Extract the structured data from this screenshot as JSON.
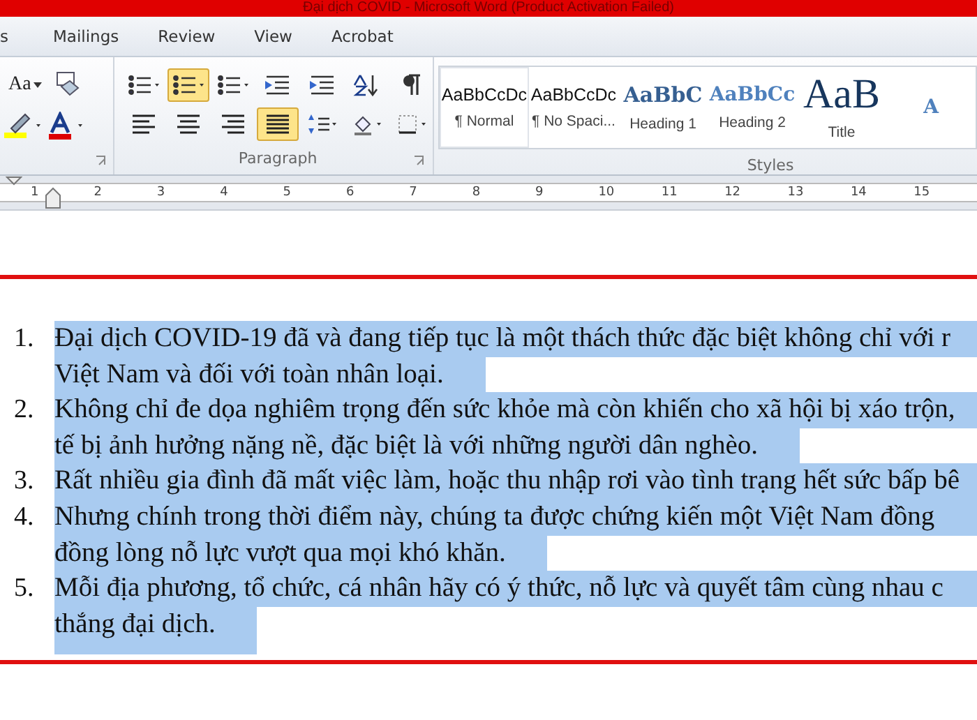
{
  "window": {
    "title": "Đại dịch COVID  -  Microsoft Word (Product Activation Failed)"
  },
  "tabs": [
    {
      "label": "s",
      "selected": false
    },
    {
      "label": "Mailings",
      "selected": false
    },
    {
      "label": "Review",
      "selected": false
    },
    {
      "label": "View",
      "selected": false
    },
    {
      "label": "Acrobat",
      "selected": false
    }
  ],
  "font_group": {
    "row_1": [
      {
        "kind": "change-case",
        "label": "Aa"
      },
      {
        "kind": "clear-format"
      }
    ],
    "row_2": [
      {
        "kind": "highlight"
      },
      {
        "kind": "font-color"
      }
    ]
  },
  "paragraph_group": {
    "label": "Paragraph",
    "row_1": [
      {
        "kind": "bullets",
        "selected": false
      },
      {
        "kind": "numbering",
        "selected": true
      },
      {
        "kind": "multilevel",
        "selected": false
      },
      {
        "kind": "decrease-indent",
        "selected": false
      },
      {
        "kind": "increase-indent",
        "selected": false
      },
      {
        "kind": "sort",
        "selected": false
      },
      {
        "kind": "pilcrow",
        "selected": false
      }
    ],
    "row_2": [
      {
        "kind": "align-left",
        "selected": false
      },
      {
        "kind": "align-center",
        "selected": false
      },
      {
        "kind": "align-right",
        "selected": false
      },
      {
        "kind": "justify",
        "selected": true
      },
      {
        "kind": "line-spacing",
        "selected": false
      },
      {
        "kind": "shading",
        "selected": false
      },
      {
        "kind": "borders",
        "selected": false
      }
    ]
  },
  "styles_group": {
    "label": "Styles",
    "items": [
      {
        "kind": "normal",
        "preview": "AaBbCcDc",
        "name": "¶ Normal",
        "selected": true
      },
      {
        "kind": "normal",
        "preview": "AaBbCcDc",
        "name": "¶ No Spaci...",
        "selected": false
      },
      {
        "kind": "heading1",
        "preview": "AaBbC",
        "name": "Heading 1",
        "selected": false
      },
      {
        "kind": "heading2",
        "preview": "AaBbCc",
        "name": "Heading 2",
        "selected": false
      },
      {
        "kind": "title",
        "preview": "AaB",
        "name": "Title",
        "selected": false
      },
      {
        "kind": "heading2",
        "preview": "A",
        "selected": false
      }
    ]
  },
  "ruler": {
    "numbers": [
      "1",
      "2",
      "3",
      "4",
      "5",
      "6",
      "7",
      "8",
      "9",
      "10",
      "11",
      "12",
      "13",
      "14",
      "15"
    ]
  },
  "document": {
    "list": [
      {
        "number": "1.",
        "selected": true,
        "lines": [
          "Đại dịch COVID-19 đã và đang tiếp tục là một thách thức đặc biệt không chỉ với r",
          "Việt Nam và đối với toàn nhân loại."
        ]
      },
      {
        "number": "2.",
        "selected": true,
        "lines": [
          "Không chỉ đe dọa nghiêm trọng đến sức khỏe mà còn khiến cho xã hội bị xáo trộn,",
          "tế bị ảnh hưởng nặng nề, đặc biệt là với những người dân nghèo."
        ]
      },
      {
        "number": "3.",
        "selected": true,
        "lines": [
          "Rất nhiều gia đình đã mất việc làm, hoặc thu nhập rơi vào tình trạng hết sức bấp bê"
        ]
      },
      {
        "number": "4.",
        "selected": true,
        "lines": [
          "Nhưng chính trong thời điểm này, chúng ta được chứng kiến một Việt Nam đồng",
          "đồng lòng nỗ lực vượt qua mọi khó khăn."
        ]
      },
      {
        "number": "5.",
        "selected": true,
        "lines": [
          "Mỗi địa phương, tổ chức, cá nhân hãy có ý thức, nỗ lực và quyết tâm cùng nhau c",
          "thắng đại dịch."
        ]
      }
    ]
  }
}
